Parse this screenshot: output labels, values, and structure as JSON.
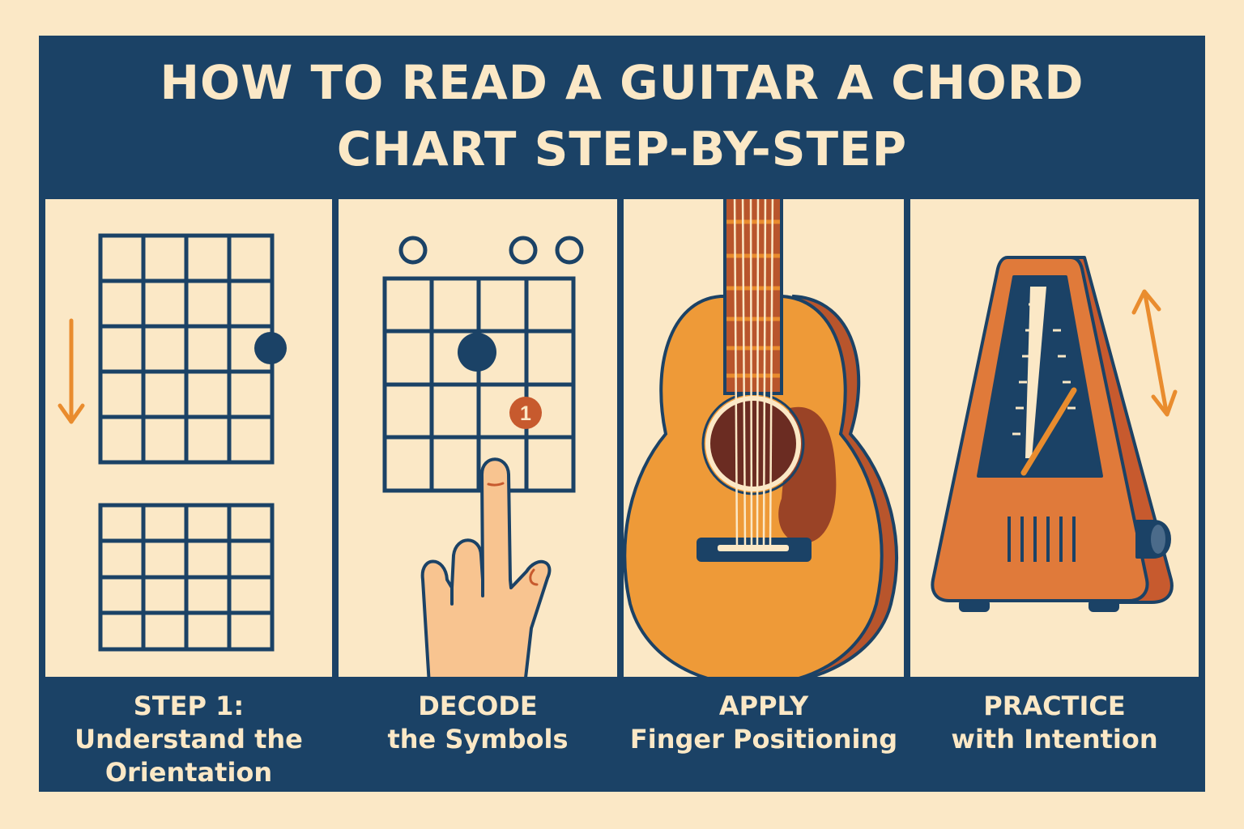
{
  "title": {
    "line1": "HOW TO READ A GUITAR A CHORD",
    "line2": "CHART STEP-BY-STEP"
  },
  "steps": [
    {
      "line1": "STEP 1:",
      "line2": "Understand the",
      "line3": "Orientation"
    },
    {
      "line1": "DECODE",
      "line2": "the Symbols"
    },
    {
      "line1": "APPLY",
      "line2": "Finger Positioning"
    },
    {
      "line1": "PRACTICE",
      "line2": "with Intention"
    }
  ],
  "diagram": {
    "finger_label": "1"
  },
  "colors": {
    "navy": "#1b4266",
    "cream": "#fbe8c6",
    "orange": "#e98c2e",
    "rust": "#c75a2e",
    "wood": "#ee9a38",
    "skin": "#f8c490"
  }
}
